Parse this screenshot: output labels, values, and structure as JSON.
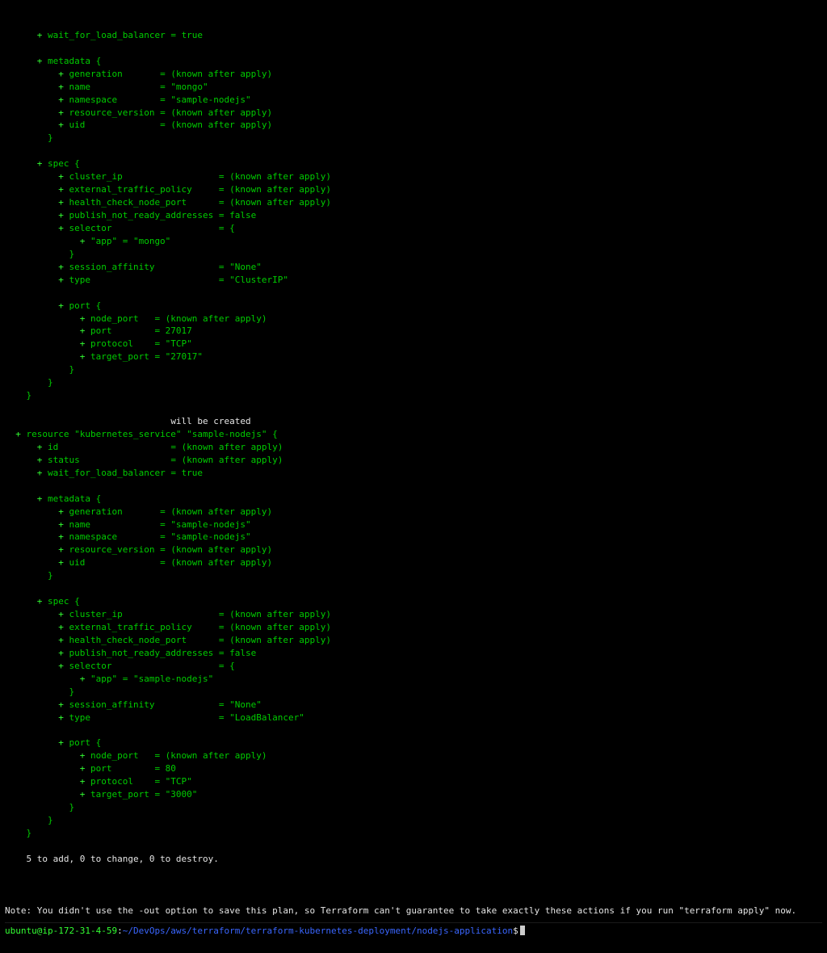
{
  "terraform_plan": {
    "plus": "+",
    "mongo_service": {
      "wait_for_lb": "wait_for_load_balancer = true",
      "metadata_open": "metadata {",
      "metadata": [
        "generation       = (known after apply)",
        "name             = \"mongo\"",
        "namespace        = \"sample-nodejs\"",
        "resource_version = (known after apply)",
        "uid              = (known after apply)"
      ],
      "close": "}",
      "spec_open": "spec {",
      "spec": [
        "cluster_ip                  = (known after apply)",
        "external_traffic_policy     = (known after apply)",
        "health_check_node_port      = (known after apply)",
        "publish_not_ready_addresses = false",
        "selector                    = {"
      ],
      "selector_line": "\"app\" = \"mongo\"",
      "spec2": [
        "session_affinity            = \"None\"",
        "type                        = \"ClusterIP\""
      ],
      "port_open": "port {",
      "port": [
        "node_port   = (known after apply)",
        "port        = 27017",
        "protocol    = \"TCP\"",
        "target_port = \"27017\""
      ]
    },
    "comment_created": "will be created",
    "resource_line": "resource \"kubernetes_service\" \"sample-nodejs\" {",
    "nodejs_service": {
      "top": [
        "id                     = (known after apply)",
        "status                 = (known after apply)",
        "wait_for_load_balancer = true"
      ],
      "metadata_open": "metadata {",
      "metadata": [
        "generation       = (known after apply)",
        "name             = \"sample-nodejs\"",
        "namespace        = \"sample-nodejs\"",
        "resource_version = (known after apply)",
        "uid              = (known after apply)"
      ],
      "close": "}",
      "spec_open": "spec {",
      "spec": [
        "cluster_ip                  = (known after apply)",
        "external_traffic_policy     = (known after apply)",
        "health_check_node_port      = (known after apply)",
        "publish_not_ready_addresses = false",
        "selector                    = {"
      ],
      "selector_line": "\"app\" = \"sample-nodejs\"",
      "spec2": [
        "session_affinity            = \"None\"",
        "type                        = \"LoadBalancer\""
      ],
      "port_open": "port {",
      "port": [
        "node_port   = (known after apply)",
        "port        = 80",
        "protocol    = \"TCP\"",
        "target_port = \"3000\""
      ]
    },
    "plan_summary": "5 to add, 0 to change, 0 to destroy.",
    "note": "Note: You didn't use the -out option to save this plan, so Terraform can't guarantee to take exactly these actions if you run \"terraform apply\" now.",
    "prompt_user": "ubuntu@ip-172-31-4-59",
    "prompt_colon": ":",
    "prompt_path": "~/DevOps/aws/terraform/terraform-kubernetes-deployment/nodejs-application",
    "prompt_end": "$"
  }
}
